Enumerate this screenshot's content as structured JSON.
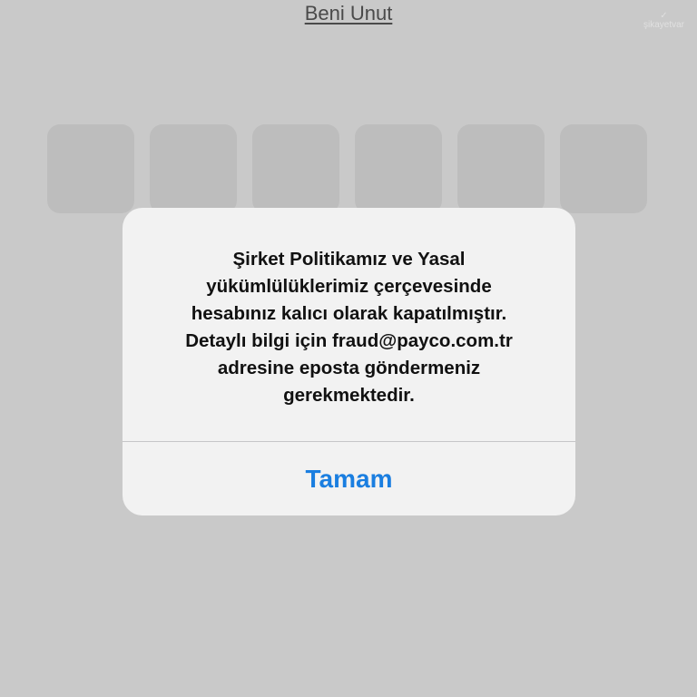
{
  "header": {
    "forget_link": "Beni Unut"
  },
  "watermark": {
    "icon": "check-icon",
    "text": "şikayetvar"
  },
  "code_input": {
    "boxes": [
      "",
      "",
      "",
      "",
      "",
      ""
    ]
  },
  "alert": {
    "message": "Şirket Politikamız ve Yasal\nyükümlülüklerimiz çerçevesinde\nhesabınız kalıcı olarak kapatılmıştır.\nDetaylı bilgi için fraud@payco.com.tr\nadresine eposta göndermeniz\ngerekmektedir.",
    "ok_button": "Tamam"
  },
  "colors": {
    "background": "#c9c9c9",
    "alert_background": "#f2f2f2",
    "accent": "#1a7ee0"
  }
}
